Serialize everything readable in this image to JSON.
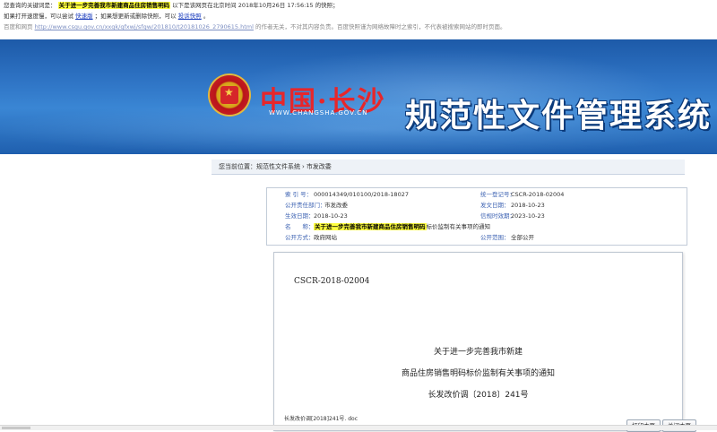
{
  "cache_bar": {
    "line1_prefix": "您查询的关键词是：",
    "keyword": "关于进一步完善我市新建商品住房销售明码",
    "line1_suffix": "以下是该网页在北京时间 2018年10月26日 17:56:15 的快照；",
    "line2_a": "如果打开速度慢，可以尝试",
    "line2_link1": "快速版",
    "line2_b": "；如果想更新或删除快照，可以",
    "line2_link2": "投诉快照",
    "line2_c": "。",
    "line3_prefix": "百度和网页",
    "line3_url": "http://www.csgu.gov.cn/xxgk/gfxwj/sfgw/201810/t20181026_2790615.html",
    "line3_suffix": "的作者无关，不对其内容负责。百度快照谨为网络故障时之索引，不代表被搜索网站的即时页面。"
  },
  "banner": {
    "logo_text": "中国·长沙",
    "logo_url": "WWW.CHANGSHA.GOV.CN",
    "system_title": "规范性文件管理系统"
  },
  "breadcrumb": {
    "label": "您当前位置：",
    "item1": "规范性文件系统",
    "sep": "›",
    "item2": "市发改委"
  },
  "meta": {
    "index_k": "索 引 号：",
    "index_v": "000014349/010100/2018-18027",
    "code_k": "统一登记号：",
    "code_v": "CSCR-2018-02004",
    "dept_k": "公开责任部门：",
    "dept_v": "市发改委",
    "pubdate_k": "发文日期：",
    "pubdate_v": "2018-10-23",
    "effdate_k": "生效日期：",
    "effdate_v": "2018-10-23",
    "expdate_k": "信规时效期：",
    "expdate_v": "2023-10-23",
    "name_k": "名　　称：",
    "name_v_hl": "关于进一步完善我市新建商品住房销售明码",
    "name_v_rest": "标价监制有关事项的通知",
    "mode_k": "公开方式：",
    "mode_v": "政府网站",
    "scope_k": "公开范围：",
    "scope_v": "全部公开"
  },
  "document": {
    "code": "CSCR-2018-02004",
    "title1": "关于进一步完善我市新建",
    "title2": "商品住房销售明码标价监制有关事项的通知",
    "docno": "长发改价调〔2018〕241号",
    "filename": "长发改价调[2018]241号. doc"
  },
  "buttons": {
    "print": "打印本页",
    "close": "关闭本页"
  }
}
